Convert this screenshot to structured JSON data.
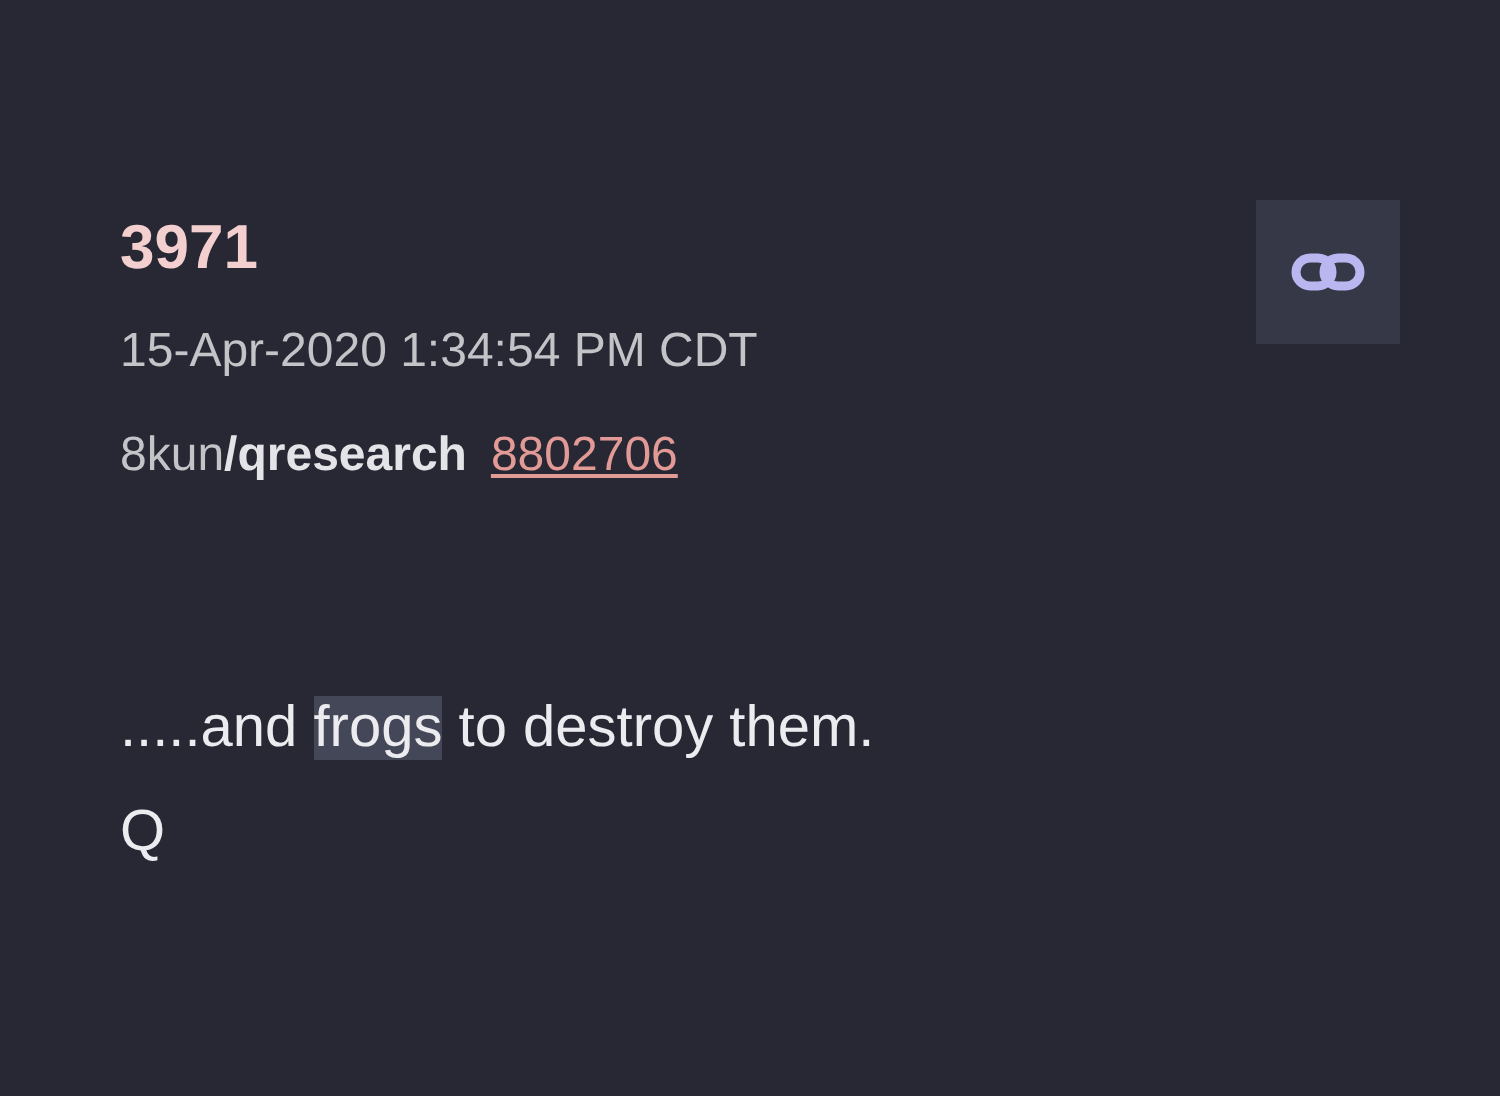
{
  "post": {
    "number": "3971",
    "timestamp": "15-Apr-2020 1:34:54 PM CDT",
    "site": "8kun",
    "board": "/qresearch",
    "source_post": "8802706"
  },
  "body": {
    "segments": [
      {
        "text": ".....and ",
        "highlighted": false
      },
      {
        "text": "frogs",
        "highlighted": true
      },
      {
        "text": " to destroy them.",
        "highlighted": false
      }
    ],
    "signature": "Q"
  }
}
